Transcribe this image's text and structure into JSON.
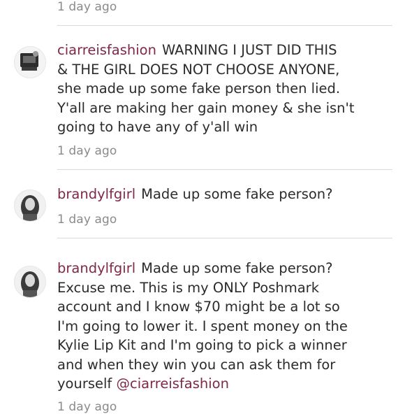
{
  "top_time": "1 day ago",
  "comments": [
    {
      "username": "ciarreisfashion",
      "lines": [
        "WARNING I JUST DID THIS",
        "& THE GIRL DOES NOT CHOOSE ANYONE,",
        "she made up some fake person then lied.",
        "Y'all are making her gain money & she isn't",
        "going to have any of y'all win"
      ],
      "time": "1 day ago"
    },
    {
      "username": "brandylfgirl",
      "lines": [
        "Made up some fake person?"
      ],
      "time": "1 day ago"
    },
    {
      "username": "brandylfgirl",
      "lines": [
        "Made up some fake person?",
        "Excuse me. This is my ONLY Poshmark",
        "account and I know $70 might be a lot so",
        "I'm going to lower it. I spent money on the",
        "Kylie Lip Kit and I'm going to pick a winner",
        "and when they win you can ask them for",
        "yourself "
      ],
      "mention": "@ciarreisfashion",
      "time": "1 day ago"
    }
  ]
}
